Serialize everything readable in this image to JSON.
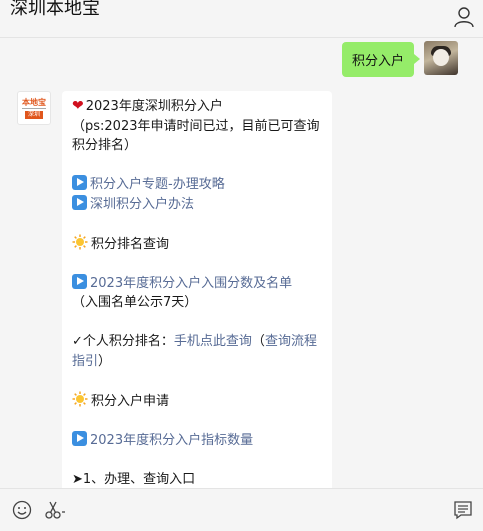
{
  "window": {
    "title": "深圳本地宝"
  },
  "icons": {
    "profile": "person-icon",
    "emoji": "smile-icon",
    "screenshot": "scissors-icon",
    "chat_history": "message-icon",
    "bullet_play": "play-button-icon",
    "heart": "red-heart-icon",
    "sun": "sun-icon"
  },
  "colors": {
    "outgoing_bubble": "#95ec69",
    "link": "#576b95",
    "play_icon": "#3b8fe0",
    "logo": "#e0561c"
  },
  "outgoing_message": {
    "text": "积分入户"
  },
  "bot": {
    "logo_top": "本地宝",
    "logo_tag": "深圳"
  },
  "message": {
    "heart": "❤",
    "title": "2023年度深圳积分入户",
    "note": "（ps:2023年申请时间已过，目前已可查询积分排名）",
    "link1": "积分入户专题-办理攻略",
    "link2": "深圳积分入户办法",
    "section1": "积分排名查询",
    "link3": "2023年度积分入户入围分数及名单",
    "note2": "（入围名单公示7天）",
    "check_prefix": "✓个人积分排名：",
    "link4": "手机点此查询",
    "paren_open": "（",
    "link5": "查询流程指引",
    "paren_close": "）",
    "section2": "积分入户申请",
    "link6": "2023年度积分入户指标数量",
    "arrow_item": "➤1、办理、查询入口"
  }
}
